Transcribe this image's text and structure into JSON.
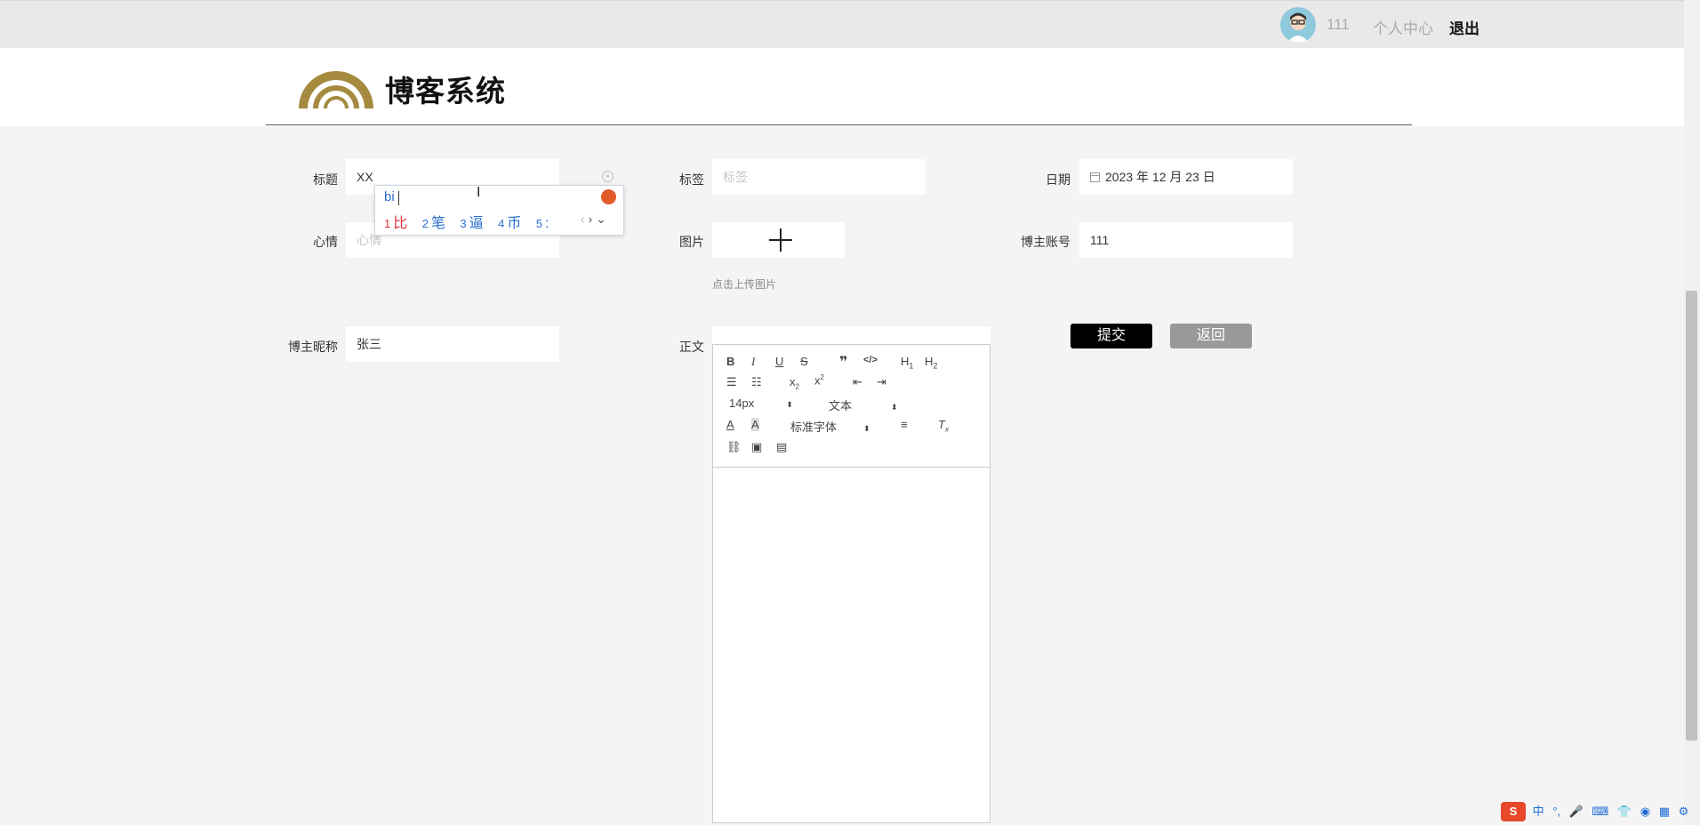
{
  "topbar": {
    "username": "111",
    "personal_center": "个人中心",
    "logout": "退出"
  },
  "brand": {
    "title": "博客系统"
  },
  "form": {
    "title": {
      "label": "标题",
      "value": "XX"
    },
    "tags": {
      "label": "标签",
      "placeholder": "标签"
    },
    "date": {
      "label": "日期",
      "value": "2023 年 12 月 23 日"
    },
    "mood": {
      "label": "心情",
      "placeholder": "心情"
    },
    "image": {
      "label": "图片",
      "hint": "点击上传图片"
    },
    "account": {
      "label": "博主账号",
      "value": "111"
    },
    "nickname": {
      "label": "博主昵称",
      "value": "张三"
    },
    "content": {
      "label": "正文"
    }
  },
  "buttons": {
    "submit": "提交",
    "back": "返回"
  },
  "editor": {
    "font_size": "14px",
    "format": "文本",
    "font_family": "标准字体"
  },
  "ime": {
    "pinyin": "bi",
    "candidates": [
      {
        "num": "1",
        "text": "比"
      },
      {
        "num": "2",
        "text": "笔"
      },
      {
        "num": "3",
        "text": "逼"
      },
      {
        "num": "4",
        "text": "币"
      },
      {
        "num": "5",
        "text": ":"
      }
    ]
  },
  "taskbar": {
    "lang": "中",
    "punct": "°,"
  },
  "colors": {
    "ime_highlight": "#e0303a",
    "ime_text": "#2a6fcf",
    "submit_bg": "#000000",
    "back_bg": "#999999"
  },
  "icons": [
    "avatar",
    "clear-icon",
    "calendar-icon",
    "plus-icon",
    "bold-icon",
    "italic-icon",
    "underline-icon",
    "strikethrough-icon",
    "quote-icon",
    "code-icon",
    "h1-icon",
    "h2-icon",
    "ordered-list-icon",
    "bullet-list-icon",
    "subscript-icon",
    "superscript-icon",
    "outdent-icon",
    "indent-icon",
    "font-color-icon",
    "background-color-icon",
    "align-icon",
    "clear-format-icon",
    "link-icon",
    "image-icon",
    "video-icon",
    "sogou-logo"
  ]
}
